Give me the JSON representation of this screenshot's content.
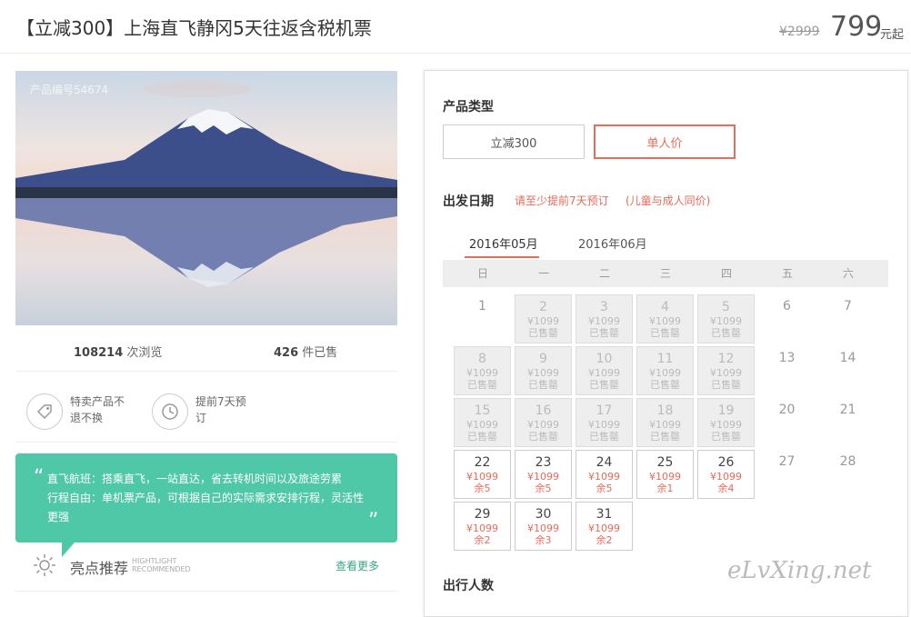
{
  "header": {
    "title": "【立减300】上海直飞静冈5天往返含税机票",
    "original_price": "¥2999",
    "price": "799",
    "price_unit": "元起"
  },
  "product": {
    "code": "产品编号54674",
    "views_count": "108214",
    "views_label": "次浏览",
    "sold_count": "426",
    "sold_label": "件已售",
    "features": [
      {
        "icon": "tag-icon",
        "text": "特卖产品不退不换"
      },
      {
        "icon": "clock-icon",
        "text": "提前7天预订"
      }
    ]
  },
  "highlight": {
    "lines": [
      "直飞航班：搭乘直飞，一站直达，省去转机时间以及旅途劳累",
      "行程自由：单机票产品，可根据自己的实际需求安排行程，灵活性",
      "更强"
    ],
    "title": "亮点推荐",
    "subtitle_en_1": "HIGHTLIGHT",
    "subtitle_en_2": "RECOMMENDED",
    "more": "查看更多",
    "accent": "#4fc8a8"
  },
  "booking": {
    "type_label": "产品类型",
    "types": [
      "立减300",
      "单人价"
    ],
    "date_label": "出发日期",
    "note1": "请至少提前7天预订",
    "note2": "(儿童与成人同价)",
    "months": [
      "2016年05月",
      "2016年06月"
    ],
    "weekdays": [
      "日",
      "一",
      "二",
      "三",
      "四",
      "五",
      "六"
    ],
    "travelers_label": "出行人数",
    "accent": "#ea6a5a"
  },
  "calendar": [
    {
      "day": "1",
      "state": "plain"
    },
    {
      "day": "2",
      "state": "soldout",
      "price": "¥1099",
      "status": "已售罄"
    },
    {
      "day": "3",
      "state": "soldout",
      "price": "¥1099",
      "status": "已售罄"
    },
    {
      "day": "4",
      "state": "soldout",
      "price": "¥1099",
      "status": "已售罄"
    },
    {
      "day": "5",
      "state": "soldout",
      "price": "¥1099",
      "status": "已售罄"
    },
    {
      "day": "6",
      "state": "plain"
    },
    {
      "day": "7",
      "state": "plain"
    },
    {
      "day": "8",
      "state": "soldout",
      "price": "¥1099",
      "status": "已售罄"
    },
    {
      "day": "9",
      "state": "soldout",
      "price": "¥1099",
      "status": "已售罄"
    },
    {
      "day": "10",
      "state": "soldout",
      "price": "¥1099",
      "status": "已售罄"
    },
    {
      "day": "11",
      "state": "soldout",
      "price": "¥1099",
      "status": "已售罄"
    },
    {
      "day": "12",
      "state": "soldout",
      "price": "¥1099",
      "status": "已售罄"
    },
    {
      "day": "13",
      "state": "plain"
    },
    {
      "day": "14",
      "state": "plain"
    },
    {
      "day": "15",
      "state": "soldout",
      "price": "¥1099",
      "status": "已售罄"
    },
    {
      "day": "16",
      "state": "soldout",
      "price": "¥1099",
      "status": "已售罄"
    },
    {
      "day": "17",
      "state": "soldout",
      "price": "¥1099",
      "status": "已售罄"
    },
    {
      "day": "18",
      "state": "soldout",
      "price": "¥1099",
      "status": "已售罄"
    },
    {
      "day": "19",
      "state": "soldout",
      "price": "¥1099",
      "status": "已售罄"
    },
    {
      "day": "20",
      "state": "plain"
    },
    {
      "day": "21",
      "state": "plain"
    },
    {
      "day": "22",
      "state": "available",
      "price": "¥1099",
      "status": "余5"
    },
    {
      "day": "23",
      "state": "available",
      "price": "¥1099",
      "status": "余5"
    },
    {
      "day": "24",
      "state": "available",
      "price": "¥1099",
      "status": "余5"
    },
    {
      "day": "25",
      "state": "available",
      "price": "¥1099",
      "status": "余1"
    },
    {
      "day": "26",
      "state": "available",
      "price": "¥1099",
      "status": "余4"
    },
    {
      "day": "27",
      "state": "plain"
    },
    {
      "day": "28",
      "state": "plain"
    },
    {
      "day": "29",
      "state": "available",
      "price": "¥1099",
      "status": "余2"
    },
    {
      "day": "30",
      "state": "available",
      "price": "¥1099",
      "status": "余3"
    },
    {
      "day": "31",
      "state": "available",
      "price": "¥1099",
      "status": "余2"
    }
  ],
  "watermark": "eLvXing.net"
}
